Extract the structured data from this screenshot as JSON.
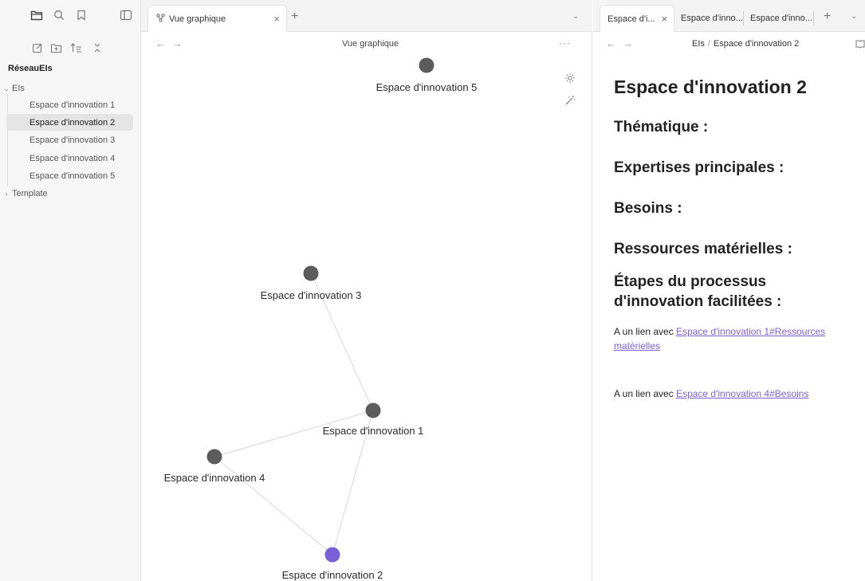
{
  "sidebar": {
    "top_icons": [
      "folder-icon",
      "search-icon",
      "bookmark-icon",
      "sidebar-toggle-icon"
    ],
    "action_icons": [
      "new-note-icon",
      "new-folder-icon",
      "sort-icon",
      "collapse-icon"
    ],
    "vault_name": "RéseauEIs",
    "folders": [
      {
        "label": "EIs",
        "expanded": true,
        "chevron": "⌄"
      },
      {
        "label": "Template",
        "expanded": false,
        "chevron": "›"
      }
    ],
    "files": [
      {
        "label": "Espace d'innovation 1",
        "active": false
      },
      {
        "label": "Espace d'innovation 2",
        "active": true
      },
      {
        "label": "Espace d'innovation 3",
        "active": false
      },
      {
        "label": "Espace d'innovation 4",
        "active": false
      },
      {
        "label": "Espace d'innovation 5",
        "active": false
      }
    ]
  },
  "graph_pane": {
    "tab": {
      "label": "Vue graphique",
      "icon": "graph-icon",
      "close": "×"
    },
    "new_tab": "+",
    "tab_list": "⌄",
    "back": "←",
    "forward": "→",
    "title": "Vue graphique",
    "more": "···",
    "controls": [
      "settings-gear-icon",
      "animate-wand-icon"
    ],
    "nodes": [
      {
        "label": "Espace d'innovation 5",
        "color": "#5c5c5c"
      },
      {
        "label": "Espace d'innovation 3",
        "color": "#5c5c5c"
      },
      {
        "label": "Espace d'innovation 1",
        "color": "#5c5c5c"
      },
      {
        "label": "Espace d'innovation 4",
        "color": "#5c5c5c"
      },
      {
        "label": "Espace d'innovation 2",
        "color": "#7b5fd9"
      }
    ],
    "edges": [
      [
        "Espace d'innovation 3",
        "Espace d'innovation 1"
      ],
      [
        "Espace d'innovation 4",
        "Espace d'innovation 1"
      ],
      [
        "Espace d'innovation 1",
        "Espace d'innovation 2"
      ],
      [
        "Espace d'innovation 4",
        "Espace d'innovation 2"
      ]
    ],
    "edge_color": "#d8d8d8",
    "active_color": "#7b5fd9"
  },
  "note_pane": {
    "tabs": [
      {
        "label": "Espace d'i...",
        "active": true,
        "close": "×"
      },
      {
        "label": "Espace d'inno...",
        "active": false
      },
      {
        "label": "Espace d'inno...",
        "active": false
      }
    ],
    "new_tab": "+",
    "tab_list": "⌄",
    "back": "←",
    "forward": "→",
    "breadcrumb": {
      "folder": "EIs",
      "sep": "/",
      "note": "Espace d'innovation 2"
    },
    "reading_icon": "book-icon",
    "title": "Espace d'innovation 2",
    "headings": [
      "Thématique :",
      "Expertises principales :",
      "Besoins :",
      "Ressources matérielles :",
      "Étapes du processus d'innovation facilitées :"
    ],
    "paragraphs": [
      {
        "prefix": "A un lien avec ",
        "link": "Espace d'innovation 1#Ressources matérielles"
      },
      {
        "prefix": "A un lien avec ",
        "link": "Espace d'innovation 4#Besoins"
      }
    ]
  }
}
